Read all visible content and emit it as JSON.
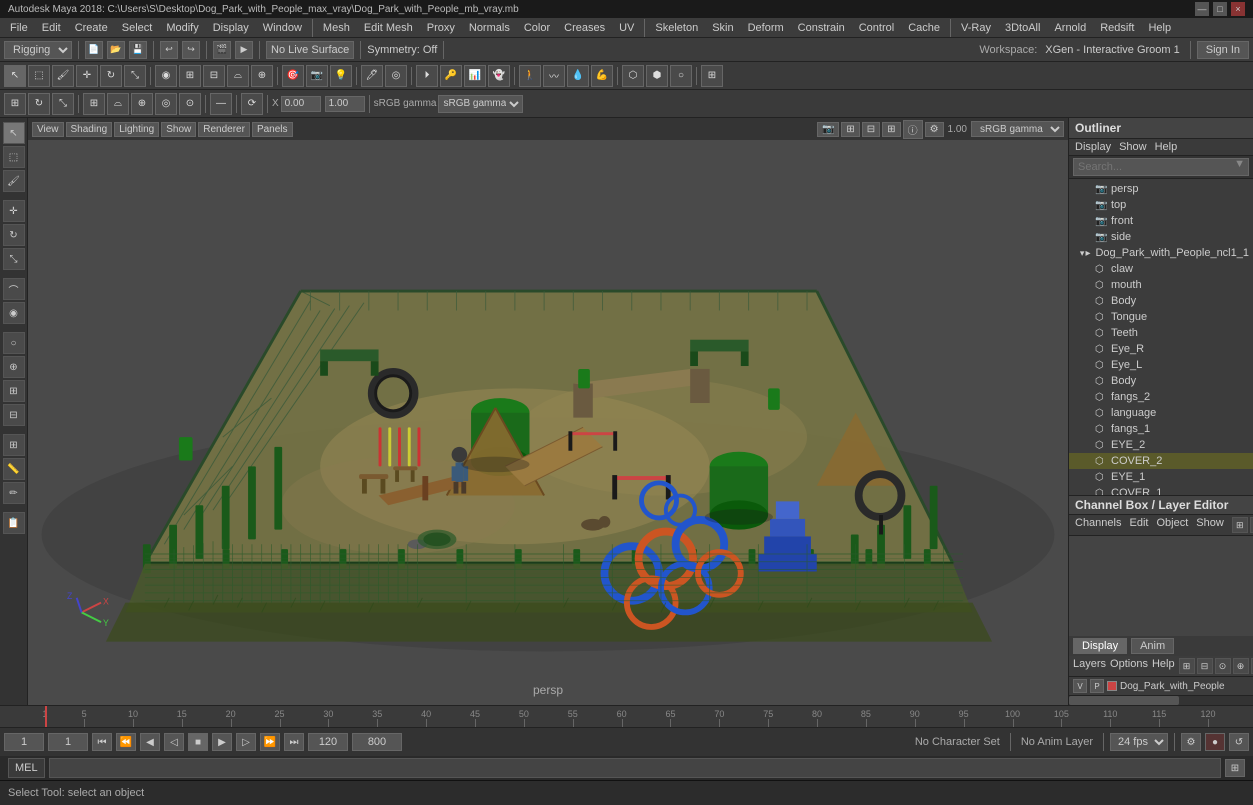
{
  "title_bar": {
    "title": "Autodesk Maya 2018: C:\\Users\\S\\Desktop\\Dog_Park_with_People_max_vray\\Dog_Park_with_People_mb_vray.mb",
    "minimize": "—",
    "maximize": "□",
    "close": "×"
  },
  "menu_bar": {
    "items": [
      "File",
      "Edit",
      "Create",
      "Select",
      "Modify",
      "Display",
      "Window",
      "Mesh",
      "Edit Mesh",
      "Proxy",
      "Normals",
      "Color",
      "Creases",
      "UV",
      "Skeleton",
      "Skin",
      "Deform",
      "Constrain",
      "Control",
      "Cache",
      "V-Ray",
      "3DtoAll",
      "Arnold",
      "Redsift",
      "Help"
    ]
  },
  "workspace_bar": {
    "rigging_dropdown": "Rigging",
    "symmetry_label": "Symmetry: Off",
    "no_live_surface": "No Live Surface",
    "workspace_label": "Workspace:",
    "xgen_label": "XGen - Interactive Groom 1",
    "sign_in": "Sign In"
  },
  "viewport_toolbar": {
    "view": "View",
    "shading": "Shading",
    "lighting": "Lighting",
    "show": "Show",
    "renderer": "Renderer",
    "panels": "Panels",
    "camera_btn": "persp",
    "film_gate": "1.00",
    "color_space": "sRGB gamma"
  },
  "viewport": {
    "label": "persp",
    "bg_color": "#4a4a4a"
  },
  "outliner": {
    "title": "Outliner",
    "menu_items": [
      "Display",
      "Show",
      "Help"
    ],
    "search_placeholder": "Search...",
    "tree_items": [
      {
        "label": "persp",
        "depth": 0,
        "icon": "cam",
        "expanded": false
      },
      {
        "label": "top",
        "depth": 0,
        "icon": "cam",
        "expanded": false
      },
      {
        "label": "front",
        "depth": 0,
        "icon": "cam",
        "expanded": false
      },
      {
        "label": "side",
        "depth": 0,
        "icon": "cam",
        "expanded": false
      },
      {
        "label": "Dog_Park_with_People_ncl1_1",
        "depth": 0,
        "icon": "group",
        "expanded": true
      },
      {
        "label": "claw",
        "depth": 1,
        "icon": "mesh",
        "expanded": false
      },
      {
        "label": "mouth",
        "depth": 1,
        "icon": "mesh",
        "expanded": false
      },
      {
        "label": "Body",
        "depth": 1,
        "icon": "mesh",
        "expanded": false
      },
      {
        "label": "Tongue",
        "depth": 1,
        "icon": "mesh",
        "expanded": false
      },
      {
        "label": "Teeth",
        "depth": 1,
        "icon": "mesh",
        "expanded": false
      },
      {
        "label": "Eye_R",
        "depth": 1,
        "icon": "mesh",
        "expanded": false
      },
      {
        "label": "Eye_L",
        "depth": 1,
        "icon": "mesh",
        "expanded": false
      },
      {
        "label": "Body",
        "depth": 1,
        "icon": "mesh",
        "expanded": false
      },
      {
        "label": "fangs_2",
        "depth": 1,
        "icon": "mesh",
        "expanded": false
      },
      {
        "label": "language",
        "depth": 1,
        "icon": "mesh",
        "expanded": false
      },
      {
        "label": "fangs_1",
        "depth": 1,
        "icon": "mesh",
        "expanded": false
      },
      {
        "label": "EYE_2",
        "depth": 1,
        "icon": "mesh",
        "expanded": false
      },
      {
        "label": "COVER_2",
        "depth": 1,
        "icon": "mesh",
        "expanded": false,
        "highlighted": true
      },
      {
        "label": "EYE_1",
        "depth": 1,
        "icon": "mesh",
        "expanded": false
      },
      {
        "label": "COVER_1",
        "depth": 1,
        "icon": "mesh",
        "expanded": false
      }
    ]
  },
  "channel_box": {
    "title": "Channel Box / Layer Editor",
    "menu_items": [
      "Channels",
      "Edit",
      "Object",
      "Show"
    ],
    "tabs": [
      "Display",
      "Anim"
    ],
    "active_tab": "Display"
  },
  "layers": {
    "menu_items": [
      "Layers",
      "Options",
      "Help"
    ],
    "items": [
      {
        "label": "Dog_Park_with_People",
        "color": "#cc4444",
        "v": "V",
        "p": "P"
      }
    ]
  },
  "timeline": {
    "start": "1",
    "end": "120",
    "end2": "800",
    "current_frame": "1",
    "playback_start": "1",
    "playback_end": "120",
    "fps": "24 fps",
    "no_character": "No Character Set",
    "no_anim_layer": "No Anim Layer",
    "ticks": [
      "1",
      "5",
      "10",
      "15",
      "20",
      "25",
      "30",
      "35",
      "40",
      "45",
      "50",
      "55",
      "60",
      "65",
      "70",
      "75",
      "80",
      "85",
      "90",
      "95",
      "100",
      "105",
      "110",
      "115",
      "120"
    ],
    "playback_btn_labels": {
      "step_back_start": "⏮",
      "step_back": "⏪",
      "back_one": "◀",
      "play_back": "▶",
      "play_fwd": "▶",
      "fwd_one": "▶",
      "step_fwd": "⏩",
      "step_fwd_end": "⏭"
    }
  },
  "mel_bar": {
    "label": "MEL",
    "input_placeholder": "",
    "status_text": "Select Tool: select an object"
  },
  "icons": {
    "arrow": "▶",
    "expand": "▸",
    "collapse": "▾",
    "search": "🔍",
    "camera": "📷",
    "mesh": "⬡",
    "group": "📁",
    "lock": "🔒",
    "key": "🔑",
    "eye": "👁",
    "layer": "▤"
  }
}
